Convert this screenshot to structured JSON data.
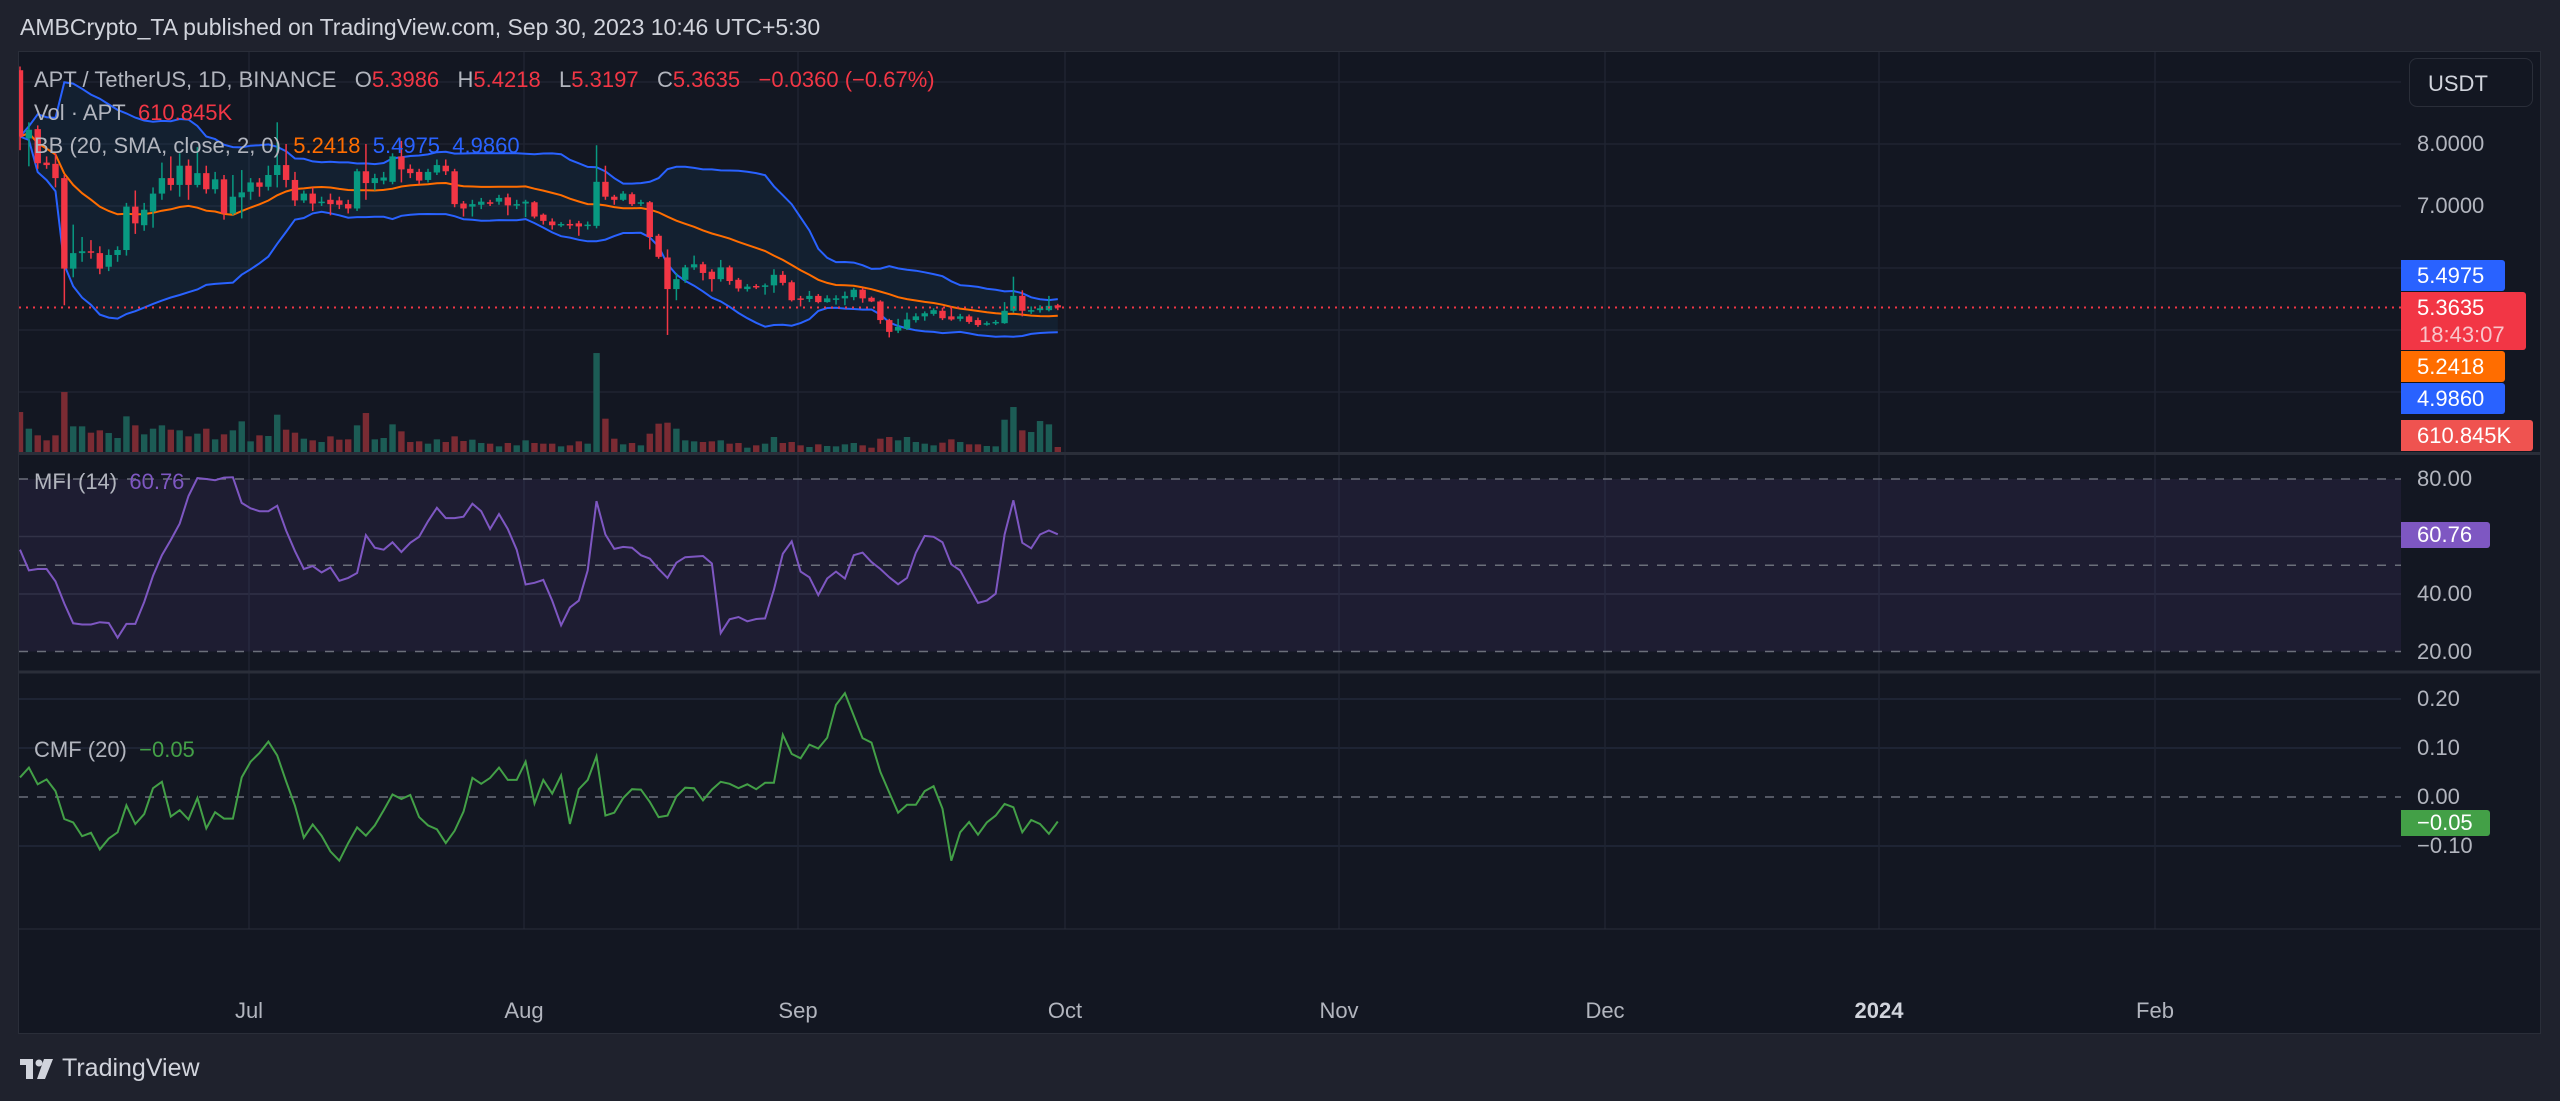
{
  "header": {
    "title": "AMBCrypto_TA published on TradingView.com, Sep 30, 2023 10:46 UTC+5:30"
  },
  "legend": {
    "symbol": "APT / TetherUS, 1D, BINANCE",
    "o_label": "O",
    "o": "5.3986",
    "h_label": "H",
    "h": "5.4218",
    "l_label": "L",
    "l": "5.3197",
    "c_label": "C",
    "c": "5.3635",
    "change": "−0.0360 (−0.67%)",
    "vol_label": "Vol · APT",
    "vol": "610.845K",
    "bb_label": "BB (20, SMA, close, 2, 0)",
    "bb_basis": "5.2418",
    "bb_upper": "5.4975",
    "bb_lower": "4.9860",
    "mfi_label": "MFI (14)",
    "mfi": "60.76",
    "cmf_label": "CMF (20)",
    "cmf": "−0.05"
  },
  "price_axis": {
    "currency_button": "USDT",
    "ticks": [
      {
        "value": 8,
        "label": "8.0000"
      },
      {
        "value": 7,
        "label": "7.0000"
      }
    ],
    "badges": {
      "bb_upper": "5.4975",
      "last": "5.3635",
      "countdown": "18:43:07",
      "bb_basis": "5.2418",
      "bb_lower": "4.9860",
      "volume": "610.845K"
    }
  },
  "mfi_axis": {
    "ticks": [
      {
        "value": 80,
        "label": "80.00"
      },
      {
        "value": 40,
        "label": "40.00"
      },
      {
        "value": 20,
        "label": "20.00"
      }
    ],
    "badge": "60.76"
  },
  "cmf_axis": {
    "ticks": [
      {
        "value": 0.2,
        "label": "0.20"
      },
      {
        "value": 0.1,
        "label": "0.10"
      },
      {
        "value": 0,
        "label": "0.00"
      },
      {
        "value": -0.1,
        "label": "−0.10"
      }
    ],
    "badge": "−0.05"
  },
  "time_axis": {
    "ticks": [
      "Jul",
      "Aug",
      "Sep",
      "Oct",
      "Nov",
      "Dec",
      "2024",
      "Feb"
    ]
  },
  "footer": {
    "brand": "TradingView"
  },
  "colors": {
    "up": "#089981",
    "down": "#f23645",
    "bb_band": "#2962ff",
    "bb_basis": "#ff6d00",
    "mfi": "#7e57c2",
    "cmf": "#43a047",
    "last_price": "#f23645"
  },
  "chart_data": {
    "type": "candlestick",
    "symbol": "APT / TetherUS, 1D, BINANCE",
    "y_range": [
      4.0,
      9.5
    ],
    "indicators": [
      "BB (20, SMA, close, 2, 0)",
      "Vol · APT",
      "MFI (14)",
      "CMF (20)"
    ],
    "candles": [
      [
        "2023-06-05",
        9.19,
        9.25,
        7.9,
        8.12,
        4884000
      ],
      [
        "2023-06-06",
        8.09,
        8.35,
        7.64,
        8.23,
        2849000
      ],
      [
        "2023-06-07",
        8.24,
        8.3,
        7.6,
        7.69,
        2035000
      ],
      [
        "2023-06-08",
        7.7,
        7.8,
        7.6,
        7.66,
        1425000
      ],
      [
        "2023-06-09",
        7.68,
        7.85,
        7.3,
        7.45,
        2035000
      ],
      [
        "2023-06-10",
        7.45,
        7.5,
        5.4,
        5.99,
        7326000
      ],
      [
        "2023-06-11",
        5.99,
        6.7,
        5.85,
        6.24,
        3134000
      ],
      [
        "2023-06-12",
        6.24,
        6.5,
        6.1,
        6.27,
        3134000
      ],
      [
        "2023-06-13",
        6.27,
        6.45,
        6.15,
        6.26,
        2361000
      ],
      [
        "2023-06-14",
        6.24,
        6.35,
        5.9,
        5.99,
        2646000
      ],
      [
        "2023-06-15",
        6.02,
        6.3,
        5.95,
        6.21,
        2320000
      ],
      [
        "2023-06-16",
        6.21,
        6.35,
        6.1,
        6.29,
        1709000
      ],
      [
        "2023-06-17",
        6.29,
        7.05,
        6.2,
        6.99,
        4355000
      ],
      [
        "2023-06-18",
        6.99,
        7.25,
        6.55,
        6.72,
        3256000
      ],
      [
        "2023-06-19",
        6.69,
        7.05,
        6.6,
        6.94,
        2157000
      ],
      [
        "2023-06-20",
        6.91,
        7.3,
        6.65,
        7.2,
        2849000
      ],
      [
        "2023-06-21",
        7.2,
        7.7,
        7.1,
        7.45,
        3256000
      ],
      [
        "2023-06-22",
        7.45,
        7.8,
        7.25,
        7.34,
        2727000
      ],
      [
        "2023-06-23",
        7.34,
        7.85,
        7.15,
        7.65,
        2646000
      ],
      [
        "2023-06-24",
        7.65,
        7.75,
        7.1,
        7.34,
        1913000
      ],
      [
        "2023-06-25",
        7.34,
        7.95,
        7.3,
        7.53,
        2239000
      ],
      [
        "2023-06-26",
        7.53,
        7.65,
        7.2,
        7.27,
        2849000
      ],
      [
        "2023-06-27",
        7.27,
        7.55,
        7.2,
        7.43,
        1547000
      ],
      [
        "2023-06-28",
        7.43,
        7.5,
        6.78,
        6.88,
        2157000
      ],
      [
        "2023-06-29",
        6.88,
        7.5,
        6.85,
        7.15,
        2646000
      ],
      [
        "2023-06-30",
        7.14,
        7.58,
        6.8,
        7.22,
        3744000
      ],
      [
        "2023-07-01",
        7.23,
        7.45,
        7.1,
        7.38,
        1302000
      ],
      [
        "2023-07-02",
        7.38,
        7.45,
        7.15,
        7.31,
        2035000
      ],
      [
        "2023-07-03",
        7.31,
        7.65,
        7.25,
        7.5,
        1954000
      ],
      [
        "2023-07-04",
        7.5,
        8.35,
        7.3,
        7.66,
        4558000
      ],
      [
        "2023-07-05",
        7.66,
        8.0,
        7.3,
        7.42,
        2727000
      ],
      [
        "2023-07-06",
        7.42,
        7.55,
        7.0,
        7.09,
        2361000
      ],
      [
        "2023-07-07",
        7.09,
        7.25,
        7.05,
        7.2,
        1628000
      ],
      [
        "2023-07-08",
        7.2,
        7.3,
        6.92,
        7.04,
        1425000
      ],
      [
        "2023-07-09",
        7.06,
        7.15,
        7.0,
        7.07,
        1221000
      ],
      [
        "2023-07-10",
        7.1,
        7.2,
        6.85,
        7.03,
        1913000
      ],
      [
        "2023-07-11",
        7.09,
        7.15,
        6.95,
        7.02,
        1506000
      ],
      [
        "2023-07-12",
        7.03,
        7.1,
        6.88,
        6.96,
        1547000
      ],
      [
        "2023-07-13",
        6.96,
        7.6,
        6.92,
        7.56,
        3256000
      ],
      [
        "2023-07-14",
        7.56,
        8.0,
        7.1,
        7.37,
        4762000
      ],
      [
        "2023-07-15",
        7.37,
        7.52,
        7.25,
        7.45,
        1547000
      ],
      [
        "2023-07-16",
        7.41,
        7.55,
        7.35,
        7.46,
        1709000
      ],
      [
        "2023-07-17",
        7.39,
        7.85,
        7.35,
        7.8,
        3378000
      ],
      [
        "2023-07-18",
        7.8,
        8.05,
        7.38,
        7.59,
        2523000
      ],
      [
        "2023-07-19",
        7.6,
        7.67,
        7.45,
        7.53,
        1221000
      ],
      [
        "2023-07-20",
        7.55,
        7.6,
        7.35,
        7.41,
        1302000
      ],
      [
        "2023-07-21",
        7.42,
        7.6,
        7.38,
        7.55,
        1018000
      ],
      [
        "2023-07-22",
        7.54,
        7.75,
        7.5,
        7.66,
        1547000
      ],
      [
        "2023-07-23",
        7.65,
        7.75,
        7.5,
        7.56,
        1221000
      ],
      [
        "2023-07-24",
        7.56,
        7.6,
        6.98,
        7.03,
        1913000
      ],
      [
        "2023-07-25",
        7.04,
        7.08,
        6.83,
        6.96,
        1343000
      ],
      [
        "2023-07-26",
        6.99,
        7.1,
        6.83,
        7.03,
        1506000
      ],
      [
        "2023-07-27",
        7.02,
        7.13,
        6.95,
        7.07,
        1099000
      ],
      [
        "2023-07-28",
        7.06,
        7.1,
        7.0,
        7.05,
        1018000
      ],
      [
        "2023-07-29",
        7.07,
        7.18,
        7.02,
        7.13,
        692000
      ],
      [
        "2023-07-30",
        7.14,
        7.2,
        6.85,
        7.01,
        1099000
      ],
      [
        "2023-07-31",
        7.02,
        7.1,
        6.95,
        7.03,
        814000
      ],
      [
        "2023-08-01",
        7.04,
        7.1,
        6.82,
        7.07,
        1425000
      ],
      [
        "2023-08-02",
        7.06,
        7.08,
        6.8,
        6.83,
        1099000
      ],
      [
        "2023-08-03",
        6.86,
        6.88,
        6.7,
        6.76,
        1018000
      ],
      [
        "2023-08-04",
        6.75,
        6.8,
        6.62,
        6.69,
        1018000
      ],
      [
        "2023-08-05",
        6.7,
        6.74,
        6.66,
        6.71,
        692000
      ],
      [
        "2023-08-06",
        6.71,
        6.78,
        6.63,
        6.69,
        814000
      ],
      [
        "2023-08-07",
        6.72,
        6.76,
        6.52,
        6.67,
        1302000
      ],
      [
        "2023-08-08",
        6.68,
        6.75,
        6.62,
        6.7,
        1018000
      ],
      [
        "2023-08-09",
        6.68,
        7.98,
        6.64,
        7.39,
        12088000
      ],
      [
        "2023-08-10",
        7.39,
        7.65,
        7.1,
        7.15,
        4070000
      ],
      [
        "2023-08-11",
        7.15,
        7.18,
        7.02,
        7.1,
        1628000
      ],
      [
        "2023-08-12",
        7.1,
        7.24,
        7.08,
        7.2,
        936000
      ],
      [
        "2023-08-13",
        7.19,
        7.22,
        7.0,
        7.03,
        1099000
      ],
      [
        "2023-08-14",
        7.04,
        7.1,
        7.0,
        7.06,
        814000
      ],
      [
        "2023-08-15",
        7.06,
        7.08,
        6.3,
        6.5,
        2239000
      ],
      [
        "2023-08-16",
        6.52,
        6.55,
        6.15,
        6.18,
        3460000
      ],
      [
        "2023-08-17",
        6.17,
        6.3,
        4.92,
        5.66,
        3582000
      ],
      [
        "2023-08-18",
        5.66,
        5.92,
        5.48,
        5.82,
        2849000
      ],
      [
        "2023-08-19",
        5.81,
        6.05,
        5.76,
        6.01,
        1425000
      ],
      [
        "2023-08-20",
        6.01,
        6.2,
        5.97,
        6.06,
        1302000
      ],
      [
        "2023-08-21",
        6.06,
        6.1,
        5.8,
        5.92,
        1221000
      ],
      [
        "2023-08-22",
        5.94,
        5.98,
        5.62,
        5.82,
        1302000
      ],
      [
        "2023-08-23",
        5.82,
        6.13,
        5.78,
        6.01,
        1425000
      ],
      [
        "2023-08-24",
        6.01,
        6.04,
        5.73,
        5.79,
        1018000
      ],
      [
        "2023-08-25",
        5.81,
        5.84,
        5.62,
        5.67,
        1099000
      ],
      [
        "2023-08-26",
        5.66,
        5.74,
        5.62,
        5.7,
        529000
      ],
      [
        "2023-08-27",
        5.71,
        5.74,
        5.66,
        5.7,
        814000
      ],
      [
        "2023-08-28",
        5.7,
        5.75,
        5.57,
        5.72,
        1018000
      ],
      [
        "2023-08-29",
        5.72,
        5.98,
        5.6,
        5.89,
        1832000
      ],
      [
        "2023-08-30",
        5.89,
        5.95,
        5.72,
        5.76,
        1099000
      ],
      [
        "2023-08-31",
        5.77,
        5.8,
        5.46,
        5.48,
        1221000
      ],
      [
        "2023-09-01",
        5.51,
        5.55,
        5.38,
        5.5,
        814000
      ],
      [
        "2023-09-02",
        5.5,
        5.63,
        5.45,
        5.55,
        611000
      ],
      [
        "2023-09-03",
        5.55,
        5.58,
        5.43,
        5.45,
        936000
      ],
      [
        "2023-09-04",
        5.45,
        5.56,
        5.44,
        5.51,
        733000
      ],
      [
        "2023-09-05",
        5.5,
        5.56,
        5.41,
        5.51,
        692000
      ],
      [
        "2023-09-06",
        5.51,
        5.62,
        5.4,
        5.55,
        936000
      ],
      [
        "2023-09-07",
        5.53,
        5.68,
        5.48,
        5.65,
        1099000
      ],
      [
        "2023-09-08",
        5.65,
        5.68,
        5.44,
        5.51,
        814000
      ],
      [
        "2023-09-09",
        5.52,
        5.54,
        5.45,
        5.46,
        529000
      ],
      [
        "2023-09-10",
        5.46,
        5.48,
        5.1,
        5.16,
        1628000
      ],
      [
        "2023-09-11",
        5.16,
        5.18,
        4.88,
        4.97,
        1832000
      ],
      [
        "2023-09-12",
        4.99,
        5.18,
        4.95,
        5.05,
        1425000
      ],
      [
        "2023-09-13",
        5.02,
        5.28,
        5.0,
        5.17,
        1832000
      ],
      [
        "2023-09-14",
        5.16,
        5.27,
        5.12,
        5.22,
        1221000
      ],
      [
        "2023-09-15",
        5.22,
        5.3,
        5.15,
        5.27,
        1018000
      ],
      [
        "2023-09-16",
        5.26,
        5.35,
        5.23,
        5.32,
        814000
      ],
      [
        "2023-09-17",
        5.31,
        5.36,
        5.16,
        5.19,
        1140000
      ],
      [
        "2023-09-18",
        5.22,
        5.37,
        5.15,
        5.17,
        1547000
      ],
      [
        "2023-09-19",
        5.18,
        5.26,
        5.14,
        5.22,
        1221000
      ],
      [
        "2023-09-20",
        5.22,
        5.25,
        5.1,
        5.13,
        936000
      ],
      [
        "2023-09-21",
        5.16,
        5.2,
        5.05,
        5.08,
        936000
      ],
      [
        "2023-09-22",
        5.1,
        5.14,
        5.07,
        5.11,
        733000
      ],
      [
        "2023-09-23",
        5.11,
        5.16,
        5.08,
        5.13,
        692000
      ],
      [
        "2023-09-24",
        5.11,
        5.45,
        5.1,
        5.31,
        3948000
      ],
      [
        "2023-09-25",
        5.31,
        5.86,
        5.28,
        5.55,
        5495000
      ],
      [
        "2023-09-26",
        5.55,
        5.64,
        5.22,
        5.31,
        2646000
      ],
      [
        "2023-09-27",
        5.31,
        5.38,
        5.26,
        5.32,
        2442000
      ],
      [
        "2023-09-28",
        5.32,
        5.4,
        5.28,
        5.35,
        3785000
      ],
      [
        "2023-09-29",
        5.32,
        5.55,
        5.3,
        5.39,
        3378000
      ],
      [
        "2023-09-30",
        5.3986,
        5.4218,
        5.3197,
        5.3635,
        610845
      ]
    ],
    "mfi": [
      55.4,
      48.2,
      48.7,
      48.7,
      44.4,
      36.7,
      29.8,
      29.4,
      29.4,
      30.2,
      29.9,
      24.8,
      29.6,
      29.6,
      37.2,
      46.3,
      53.5,
      58.8,
      64.5,
      74.1,
      80.3,
      80.0,
      79.6,
      80.5,
      80.6,
      71.7,
      69.8,
      68.8,
      68.8,
      70.7,
      62.1,
      54.9,
      48.7,
      49.7,
      47.5,
      49.2,
      44.6,
      45.6,
      47.3,
      60.5,
      56.1,
      55.4,
      58.0,
      54.6,
      57.8,
      59.9,
      65.3,
      70.0,
      66.4,
      66.4,
      66.9,
      71.4,
      68.8,
      62.6,
      67.8,
      62.6,
      55.4,
      43.3,
      43.9,
      44.9,
      37.7,
      29.1,
      35.3,
      37.7,
      48.2,
      72.3,
      60.7,
      55.7,
      56.4,
      56.1,
      53.5,
      52.3,
      48.7,
      45.6,
      50.9,
      52.8,
      53.0,
      53.2,
      50.6,
      26.4,
      31.2,
      32.0,
      30.5,
      31.3,
      31.5,
      41.5,
      54.0,
      58.3,
      47.8,
      45.8,
      39.6,
      45.4,
      47.8,
      45.4,
      53.5,
      54.4,
      51.1,
      48.7,
      45.8,
      43.4,
      45.6,
      54.4,
      60.2,
      59.9,
      58.0,
      50.3,
      48.2,
      42.5,
      36.9,
      37.7,
      40.1,
      60.7,
      72.6,
      57.8,
      55.9,
      60.7,
      62.1,
      60.76
    ],
    "cmf": [
      0.04,
      0.06,
      0.026,
      0.036,
      0.012,
      -0.045,
      -0.052,
      -0.08,
      -0.073,
      -0.107,
      -0.085,
      -0.072,
      -0.017,
      -0.055,
      -0.035,
      0.018,
      0.031,
      -0.04,
      -0.027,
      -0.046,
      -0.002,
      -0.064,
      -0.031,
      -0.044,
      -0.044,
      0.04,
      0.072,
      0.09,
      0.113,
      0.085,
      0.032,
      -0.018,
      -0.083,
      -0.056,
      -0.079,
      -0.111,
      -0.13,
      -0.094,
      -0.062,
      -0.079,
      -0.058,
      -0.027,
      0.005,
      -0.004,
      0.004,
      -0.041,
      -0.058,
      -0.066,
      -0.094,
      -0.069,
      -0.03,
      0.039,
      0.027,
      0.039,
      0.06,
      0.035,
      0.035,
      0.072,
      -0.013,
      0.035,
      0.007,
      0.044,
      -0.055,
      0.016,
      0.035,
      0.083,
      -0.038,
      -0.032,
      -0.002,
      0.016,
      0.015,
      -0.01,
      -0.041,
      -0.038,
      0.001,
      0.019,
      0.018,
      -0.007,
      0.015,
      0.031,
      0.027,
      0.018,
      0.026,
      0.016,
      0.029,
      0.029,
      0.127,
      0.088,
      0.079,
      0.107,
      0.099,
      0.121,
      0.188,
      0.212,
      0.166,
      0.12,
      0.111,
      0.051,
      0.009,
      -0.032,
      -0.016,
      -0.016,
      0.012,
      0.022,
      -0.024,
      -0.13,
      -0.072,
      -0.051,
      -0.077,
      -0.052,
      -0.038,
      -0.014,
      -0.021,
      -0.072,
      -0.047,
      -0.055,
      -0.075,
      -0.05
    ],
    "mfi_levels": [
      80,
      50,
      20
    ],
    "cmf_zero_line": 0,
    "grid": true
  }
}
